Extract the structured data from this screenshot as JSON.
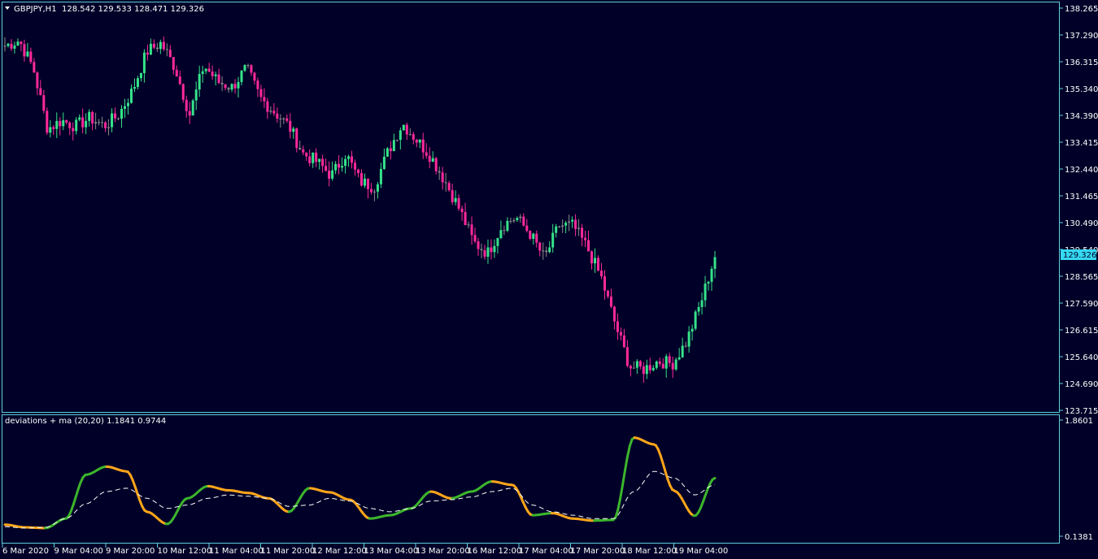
{
  "header": {
    "symbol": "GBPJPY,H1",
    "ohlc": "128.542 129.533 128.471 129.326"
  },
  "indicator": {
    "label": "deviations + ma (20,20) 1.1841 0.9744",
    "scale_top": "1.8601",
    "scale_bottom": "0.1381"
  },
  "current_price": "129.326",
  "colors": {
    "background": "#000028",
    "frame": "#5fd0e0",
    "bull": "#36e38a",
    "bear": "#ff2a9a",
    "doji": "#8a8a8a",
    "dev_up": "#3cb52c",
    "dev_down": "#ffa51a",
    "ma": "#ffffff",
    "price_tag": "#35d8f0"
  },
  "price_axis_labels": [
    "138.265",
    "137.290",
    "136.315",
    "135.340",
    "134.390",
    "133.415",
    "132.440",
    "131.465",
    "130.490",
    "129.540",
    "128.565",
    "127.590",
    "126.615",
    "125.640",
    "124.690",
    "123.715"
  ],
  "time_axis_labels": [
    "6 Mar 2020",
    "9 Mar 04:00",
    "9 Mar 20:00",
    "10 Mar 12:00",
    "11 Mar 04:00",
    "11 Mar 20:00",
    "12 Mar 12:00",
    "13 Mar 04:00",
    "13 Mar 20:00",
    "16 Mar 12:00",
    "17 Mar 04:00",
    "17 Mar 20:00",
    "18 Mar 12:00",
    "19 Mar 04:00"
  ],
  "chart_data": [
    {
      "type": "candlestick",
      "series_shape": {
        "y_range": [
          123.715,
          138.265
        ],
        "anchor_closes": [
          136.9,
          137.1,
          136.1,
          133.9,
          134.2,
          134.0,
          134.3,
          134.0,
          134.4,
          135.3,
          136.7,
          137.0,
          136.1,
          134.4,
          136.2,
          135.6,
          135.4,
          136.1,
          135.0,
          134.5,
          134.0,
          133.0,
          132.7,
          132.2,
          133.0,
          132.0,
          131.8,
          133.1,
          134.1,
          133.5,
          132.9,
          132.0,
          131.0,
          129.8,
          129.4,
          130.4,
          130.7,
          130.1,
          129.2,
          130.4,
          130.4,
          129.6,
          128.5,
          126.8,
          125.3,
          125.2,
          125.5,
          125.4,
          126.2,
          127.6,
          129.3
        ]
      }
    },
    {
      "type": "line",
      "series_shape": {
        "y_range": [
          0.1381,
          1.8601
        ],
        "deviation_anchors": [
          0.31,
          0.27,
          0.26,
          0.4,
          1.05,
          1.17,
          1.1,
          0.5,
          0.32,
          0.7,
          0.88,
          0.82,
          0.78,
          0.7,
          0.5,
          0.85,
          0.79,
          0.68,
          0.4,
          0.45,
          0.55,
          0.8,
          0.7,
          0.8,
          0.95,
          0.9,
          0.45,
          0.48,
          0.4,
          0.37,
          0.38,
          1.6,
          1.5,
          0.81,
          0.44,
          1.0
        ],
        "ma_anchors": [
          0.28,
          0.26,
          0.27,
          0.4,
          0.62,
          0.8,
          0.85,
          0.7,
          0.55,
          0.6,
          0.7,
          0.75,
          0.73,
          0.7,
          0.58,
          0.6,
          0.7,
          0.66,
          0.55,
          0.5,
          0.55,
          0.66,
          0.68,
          0.72,
          0.8,
          0.85,
          0.6,
          0.5,
          0.45,
          0.4,
          0.4,
          0.8,
          1.1,
          1.0,
          0.75,
          0.9
        ]
      }
    }
  ]
}
